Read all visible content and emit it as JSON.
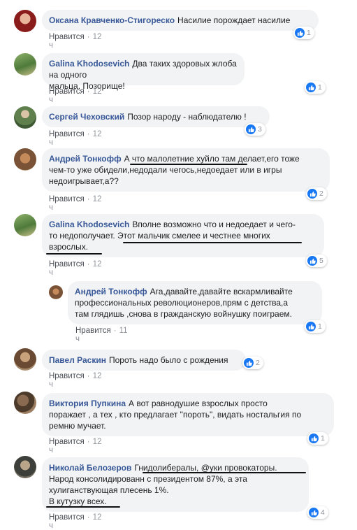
{
  "comments": [
    {
      "author": "Оксана Кравченко-Стигореско",
      "lines": [
        "Насилие порождает насилие"
      ],
      "like_label": "Нравится",
      "time": "12 ч",
      "reactions": "1"
    },
    {
      "author": "Galina Khodosevich",
      "lines": [
        "Два таких здоровых жлоба на одного",
        "мальца. Позорище!"
      ],
      "like_label": "Нравится",
      "time": "12 ч",
      "reactions": "1"
    },
    {
      "author": "Сергей Чеховский",
      "lines": [
        "Позор народу - наблюдателю !"
      ],
      "like_label": "Нравится",
      "time": "12 ч",
      "reactions": "3"
    },
    {
      "author": "Андрей Тонкофф",
      "lines": [
        "А что малолетние хуйло там делает,его тоже",
        "чем-то уже обидели,недодали чегось,недоедает или в игры",
        "недоигрывает,а??"
      ],
      "like_label": "Нравится",
      "time": "12 ч",
      "reactions": "2"
    },
    {
      "author": "Galina Khodosevich",
      "lines": [
        "Вполне возможно что и недоедает и чего-",
        "то недополучает. Этот мальчик смелее и честнее многих",
        "взрослых."
      ],
      "like_label": "Нравится",
      "time": "12 ч",
      "reactions": "5"
    },
    {
      "author": "Андрей Тонкофф",
      "lines": [
        "Ага,давайте,давайте вскармливайте",
        "профессиональных революционеров,прям с детства,а",
        "там глядишь ,снова в гражданскую войнушку поиграем."
      ],
      "like_label": "Нравится",
      "time": "11 ч",
      "reactions": "1"
    },
    {
      "author": "Павел Раскин",
      "lines": [
        "Пороть надо было с рождения"
      ],
      "like_label": "Нравится",
      "time": "12 ч",
      "reactions": "2"
    },
    {
      "author": "Виктория Пупкина",
      "lines": [
        "А вот равнодушие взрослых просто",
        "поражает , а тех , кто предлагает \"пороть\", видать ностальгия по",
        "ремню мучает."
      ],
      "like_label": "Нравится",
      "time": "12 ч",
      "reactions": "1"
    },
    {
      "author": "Николай Белозеров",
      "lines": [
        "Гнидолибералы, @уки провокаторы.",
        "Народ консолидированн с президентом 87%, а эта",
        "хулиганствующая плесень 1%.",
        "В кутузку всех."
      ],
      "like_label": "Нравится",
      "time": "12 ч",
      "reactions": "4"
    }
  ],
  "colors": {
    "author": "#385898",
    "bubble": "#f2f3f5",
    "like": "#1877f2",
    "meta": "#90949c"
  }
}
